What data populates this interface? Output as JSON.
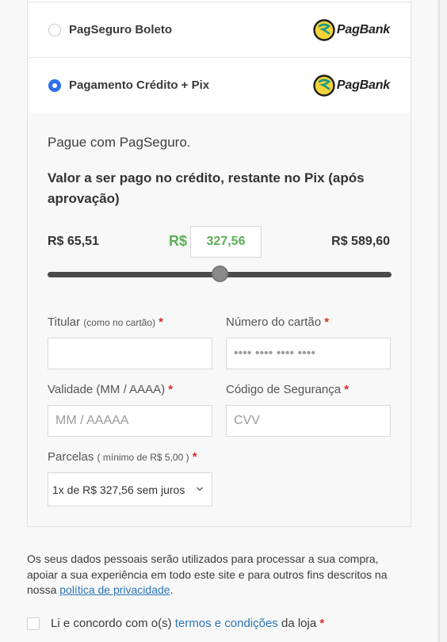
{
  "payment_methods": [
    {
      "label": "PagSeguro Boleto",
      "selected": false,
      "brand": "PagBank",
      "icon": "pagbank-logo-icon"
    },
    {
      "label": "Pagamento Crédito + Pix",
      "selected": true,
      "brand": "PagBank",
      "icon": "pagbank-logo-icon"
    }
  ],
  "panel": {
    "intro": "Pague com PagSeguro.",
    "description": "Valor a ser pago no crédito, restante no Pix (após aprovação)",
    "split": {
      "min": "R$ 65,51",
      "max": "R$ 589,60",
      "currency": "R$",
      "credit_amount": "327,56",
      "slider_fraction": 0.5
    },
    "fields": {
      "titular_label": "Titular",
      "titular_hint": "(como no cartão)",
      "titular_value": "",
      "card_number_label": "Número do cartão",
      "card_number_placeholder": "•••• •••• •••• ••••",
      "expiry_label": "Validade (MM / AAAA)",
      "expiry_placeholder": "MM / AAAAA",
      "cvv_label": "Código de Segurança",
      "cvv_placeholder": "CVV",
      "installments_label": "Parcelas",
      "installments_hint": "( mínimo de R$ 5,00 )",
      "installments_selected": "1x de R$ 327,56 sem juros",
      "required_mark": "*"
    }
  },
  "privacy": {
    "text": "Os seus dados pessoais serão utilizados para processar a sua compra, apoiar a sua experiência em todo este site e para outros fins descritos na nossa ",
    "link": "política de privacidade",
    "end": "."
  },
  "terms": {
    "prefix": "Li e concordo com o(s) ",
    "link": "termos e condições",
    "suffix": " da loja",
    "required_mark": "*",
    "checked": false
  },
  "colors": {
    "accent_radio": "#2f6fed",
    "amount_green": "#5cae57",
    "required_red": "#d72b2b",
    "link_blue": "#2b73b8"
  }
}
